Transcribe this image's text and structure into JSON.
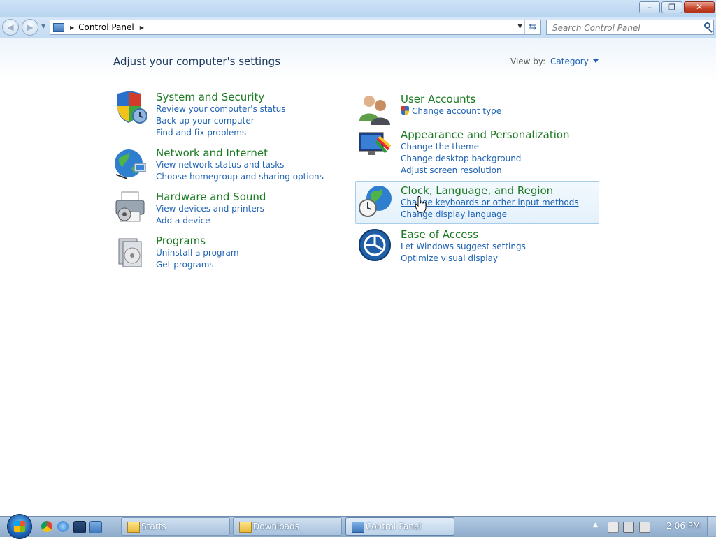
{
  "window": {
    "minimize": "–",
    "maximize": "❐",
    "close": "✕"
  },
  "nav": {
    "back": "◀",
    "forward": "▶",
    "breadcrumb": "Control Panel",
    "search_placeholder": "Search Control Panel"
  },
  "main": {
    "heading": "Adjust your computer's settings",
    "view_by_label": "View by:",
    "view_by_value": "Category"
  },
  "categories": {
    "system": {
      "title": "System and Security",
      "links": [
        "Review your computer's status",
        "Back up your computer",
        "Find and fix problems"
      ]
    },
    "network": {
      "title": "Network and Internet",
      "links": [
        "View network status and tasks",
        "Choose homegroup and sharing options"
      ]
    },
    "hardware": {
      "title": "Hardware and Sound",
      "links": [
        "View devices and printers",
        "Add a device"
      ]
    },
    "programs": {
      "title": "Programs",
      "links": [
        "Uninstall a program",
        "Get programs"
      ]
    },
    "users": {
      "title": "User Accounts",
      "links": [
        "Change account type"
      ]
    },
    "appearance": {
      "title": "Appearance and Personalization",
      "links": [
        "Change the theme",
        "Change desktop background",
        "Adjust screen resolution"
      ]
    },
    "clock": {
      "title": "Clock, Language, and Region",
      "links": [
        "Change keyboards or other input methods",
        "Change display language"
      ]
    },
    "ease": {
      "title": "Ease of Access",
      "links": [
        "Let Windows suggest settings",
        "Optimize visual display"
      ]
    }
  },
  "taskbar": {
    "tasks": [
      "Starts",
      "Downloads",
      "Control Panel"
    ],
    "clock": "2:06 PM"
  },
  "colors": {
    "category_title": "#1a7a21",
    "link": "#1e62b3",
    "heading": "#1e395b"
  }
}
